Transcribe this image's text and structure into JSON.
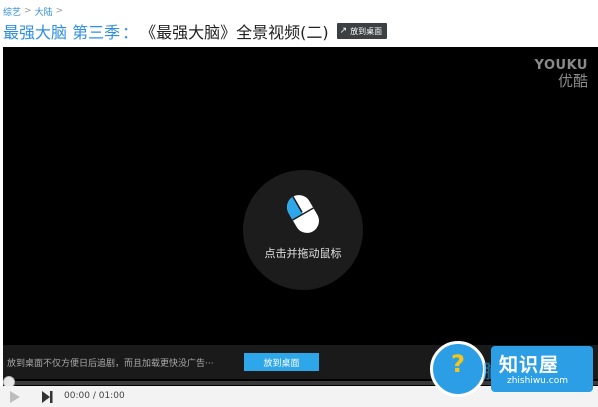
{
  "breadcrumb": {
    "items": [
      "综艺",
      "大陆"
    ],
    "separator": ">"
  },
  "title": {
    "show": "最强大脑 第三季",
    "separator": "：",
    "episode": "《最强大脑》全景视频(二)",
    "desk_button": "放到桌面"
  },
  "player": {
    "logo_en": "YOUKU",
    "logo_cn": "优酷",
    "hint_text": "点击并拖动鼠标",
    "ad_text": "放到桌面不仅方便日后追剧，而且加载更快没广告···",
    "ad_button": "放到桌面",
    "progress": 0,
    "time_current": "00:00",
    "time_separator": "/",
    "time_total": "01:00"
  },
  "watermark": {
    "text_cn": "知识屋",
    "text_en": "zhishiwu.com",
    "ghost_text": "脑",
    "badge_char": "?"
  },
  "colors": {
    "accent_blue": "#2c8fe5",
    "ad_button_blue": "#2ea7ea",
    "watermark_blue": "#2b9ee6",
    "player_bg": "#000000"
  },
  "icons": [
    "mouse-icon",
    "play-icon",
    "next-icon",
    "desktop-shortcut-icon"
  ]
}
